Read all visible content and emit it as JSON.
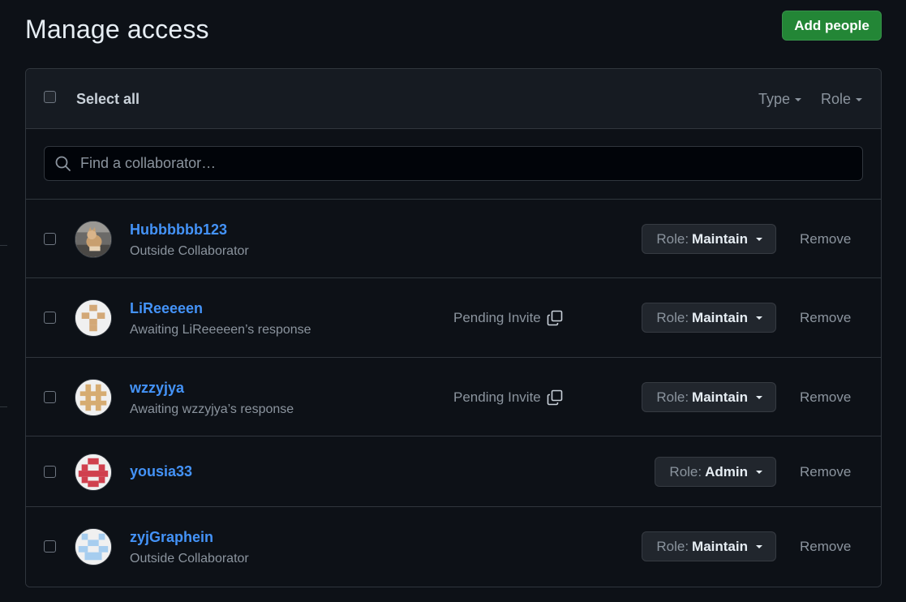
{
  "header": {
    "title": "Manage access",
    "add_button": "Add people"
  },
  "toolbar": {
    "select_all": "Select all",
    "type_filter": "Type",
    "role_filter": "Role"
  },
  "search": {
    "placeholder": "Find a collaborator…",
    "value": ""
  },
  "role_prefix": "Role:",
  "remove_label": "Remove",
  "members": [
    {
      "username": "Hubbbbbb123",
      "subtitle": "Outside Collaborator",
      "pending": "",
      "role": "Maintain",
      "avatar": "photo-avatar"
    },
    {
      "username": "LiReeeeen",
      "subtitle": "Awaiting LiReeeeen’s response",
      "pending": "Pending Invite",
      "role": "Maintain",
      "avatar": "identicon-avatar"
    },
    {
      "username": "wzzyjya",
      "subtitle": "Awaiting wzzyjya’s response",
      "pending": "Pending Invite",
      "role": "Maintain",
      "avatar": "identicon-avatar"
    },
    {
      "username": "yousia33",
      "subtitle": "",
      "pending": "",
      "role": "Admin",
      "avatar": "identicon-avatar"
    },
    {
      "username": "zyjGraphein",
      "subtitle": "Outside Collaborator",
      "pending": "",
      "role": "Maintain",
      "avatar": "identicon-avatar"
    }
  ],
  "colors": {
    "background": "#0d1117",
    "panel": "#161b22",
    "border": "#30363d",
    "accent_green": "#238636",
    "link_blue": "#4493f8",
    "muted_text": "#8b949e",
    "identicon_lireeeeen": "#d3a877",
    "identicon_wzzyjya": "#d6ac72",
    "identicon_yousia33": "#d0404e",
    "identicon_zyjgraphein": "#a6cdef"
  }
}
